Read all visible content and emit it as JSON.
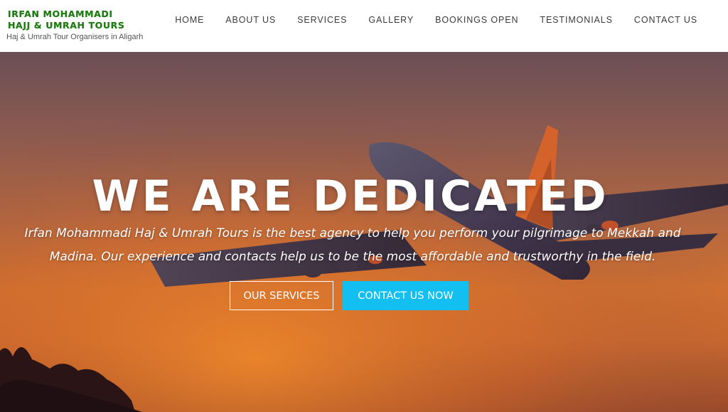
{
  "brand": {
    "line1": "IRFAN MOHAMMADI",
    "line2": "HAJJ & UMRAH TOURS",
    "tagline": "Haj & Umrah Tour Organisers in Aligarh"
  },
  "nav": {
    "items": [
      "HOME",
      "ABOUT US",
      "SERVICES",
      "GALLERY",
      "BOOKINGS OPEN",
      "TESTIMONIALS",
      "CONTACT US"
    ]
  },
  "hero": {
    "headline": "WE ARE DEDICATED",
    "description": "Irfan Mohammadi Haj & Umrah Tours is the best agency to help you perform your pilgrimage to Mekkah and Madina. Our experience and contacts help us to be the most affordable and trustworthy in the field.",
    "button_services": "OUR SERVICES",
    "button_contact": "CONTACT US NOW"
  },
  "colors": {
    "brand_green": "#1e7d12",
    "accent_cyan": "#12bff0",
    "nav_text": "#3a3a3a"
  }
}
